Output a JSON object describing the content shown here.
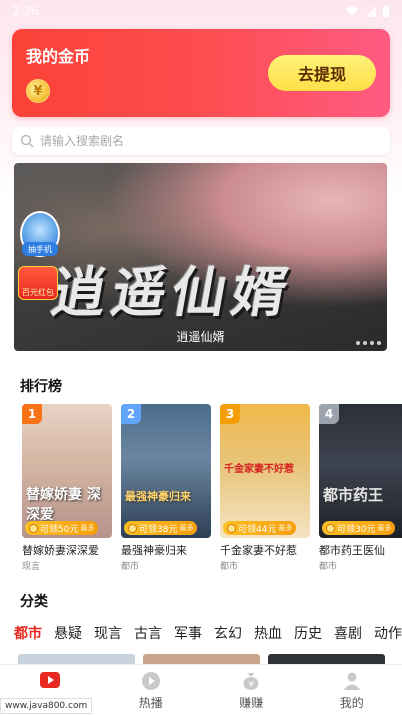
{
  "status_bar": {
    "time": "2:26"
  },
  "coin_card": {
    "title": "我的金币",
    "coin_symbol": "¥",
    "withdraw_label": "去提现"
  },
  "search": {
    "placeholder": "请输入搜索剧名"
  },
  "banner": {
    "title_art": "逍遥仙婿",
    "caption": "逍遥仙婿",
    "badge_phone_label": "抽手机",
    "badge_redpacket_label": "百元红包"
  },
  "ranking": {
    "title": "排行榜",
    "items": [
      {
        "rank": "1",
        "name": "替嫁娇妻深深爱",
        "genre": "现言",
        "reward": "可领50元",
        "reward_more": "最多",
        "poster_text": "替嫁娇妻 深深爱"
      },
      {
        "rank": "2",
        "name": "最强神豪归来",
        "genre": "都市",
        "reward": "可领38元",
        "reward_more": "最多",
        "poster_text": "最强神豪归来"
      },
      {
        "rank": "3",
        "name": "千金家妻不好惹",
        "genre": "都市",
        "reward": "可领44元",
        "reward_more": "最多",
        "poster_text": "千金家妻不好惹"
      },
      {
        "rank": "4",
        "name": "都市药王医仙",
        "genre": "都市",
        "reward": "可领30元",
        "reward_more": "最多",
        "poster_text": "都市药王"
      }
    ]
  },
  "categories": {
    "title": "分类",
    "tabs": [
      "都市",
      "悬疑",
      "现言",
      "古言",
      "军事",
      "玄幻",
      "热血",
      "历史",
      "喜剧",
      "动作"
    ]
  },
  "bottom_nav": {
    "items": [
      {
        "label": "",
        "icon": "play-icon"
      },
      {
        "label": "热播",
        "icon": "play-circle-icon"
      },
      {
        "label": "赚赚",
        "icon": "money-bag-icon"
      },
      {
        "label": "我的",
        "icon": "person-icon"
      }
    ]
  },
  "watermark": "www.java800.com",
  "colors": {
    "accent": "#e8281e",
    "coin_card_start": "#fb4238",
    "coin_card_end": "#fe5b83",
    "withdraw_button": "#fde047",
    "rank_1": "#f97316",
    "rank_2": "#60a5fa",
    "rank_3": "#f59e0b",
    "rank_4": "#9ca3af"
  }
}
